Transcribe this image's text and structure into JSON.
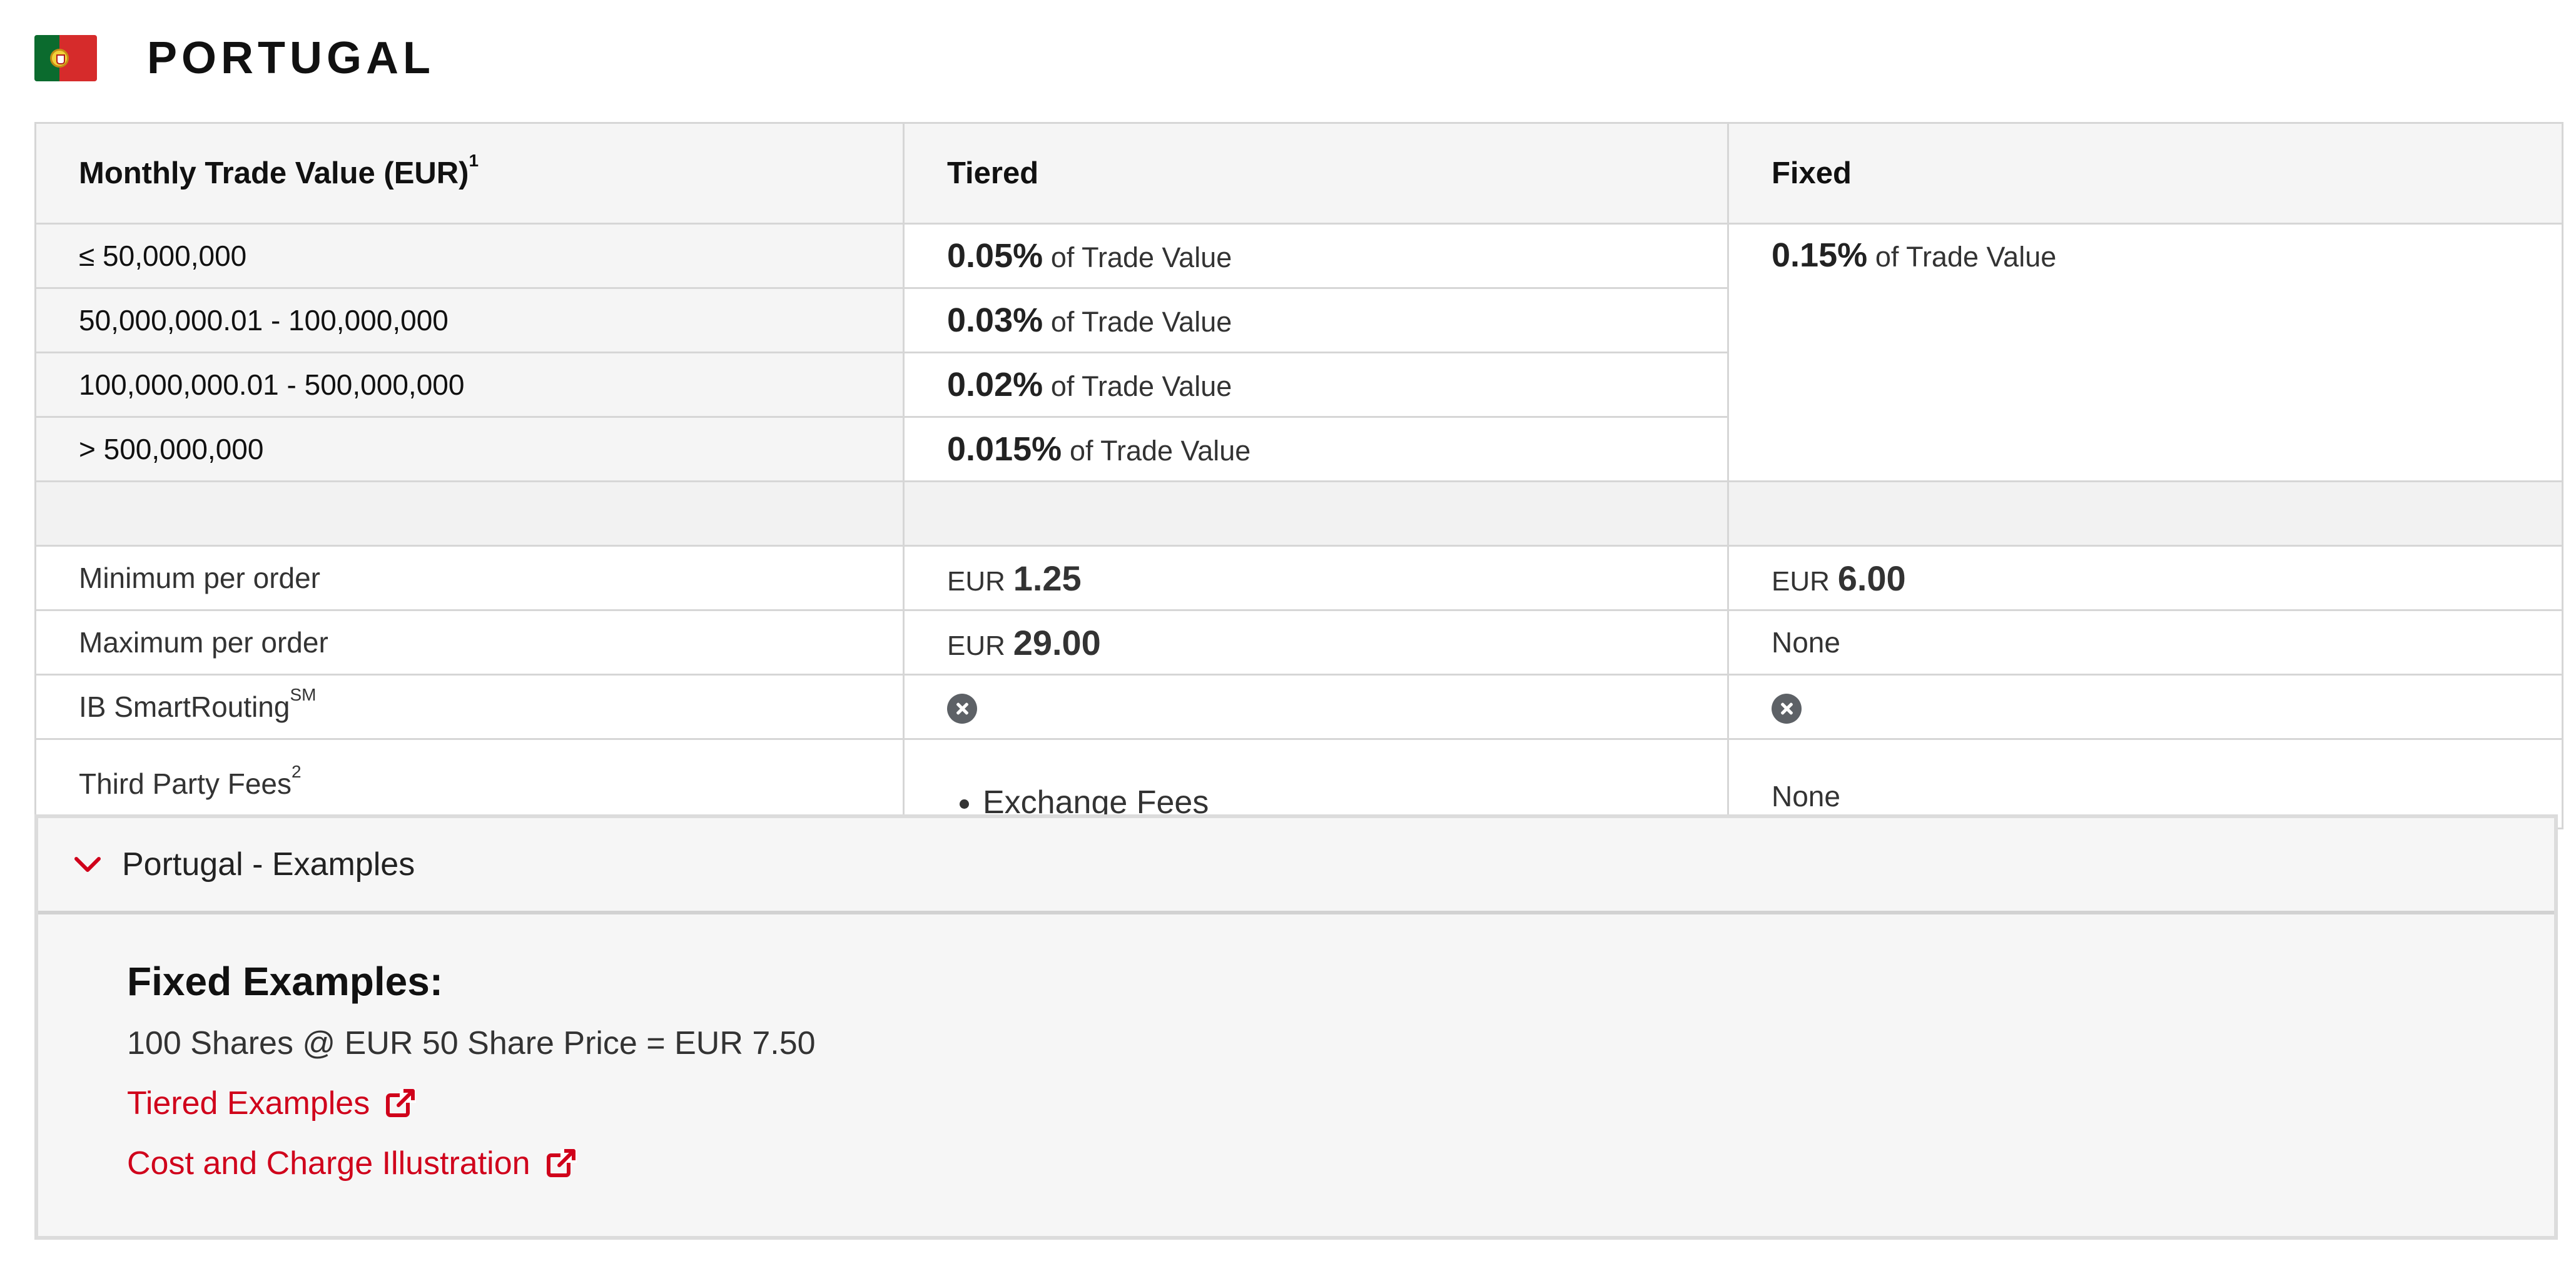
{
  "header": {
    "country": "PORTUGAL",
    "flag_icon": "portugal-flag-icon"
  },
  "table": {
    "headers": {
      "volume": "Monthly Trade Value (EUR)",
      "volume_note": "1",
      "tiered": "Tiered",
      "fixed": "Fixed"
    },
    "tiers": [
      {
        "range": "≤ 50,000,000",
        "pct": "0.05%",
        "suffix": "of Trade Value"
      },
      {
        "range": "50,000,000.01 - 100,000,000",
        "pct": "0.03%",
        "suffix": "of Trade Value"
      },
      {
        "range": "100,000,000.01 - 500,000,000",
        "pct": "0.02%",
        "suffix": "of Trade Value"
      },
      {
        "range": "> 500,000,000",
        "pct": "0.015%",
        "suffix": "of Trade Value"
      }
    ],
    "fixed_rate": {
      "pct": "0.15%",
      "suffix": "of Trade Value"
    },
    "minimum": {
      "label": "Minimum per order",
      "tiered_cur": "EUR",
      "tiered_amt": "1.25",
      "fixed_cur": "EUR",
      "fixed_amt": "6.00"
    },
    "maximum": {
      "label": "Maximum per order",
      "tiered_cur": "EUR",
      "tiered_amt": "29.00",
      "fixed": "None"
    },
    "smart_routing": {
      "label": "IB SmartRouting",
      "sup": "SM",
      "tiered_icon": "x-circle-icon",
      "fixed_icon": "x-circle-icon"
    },
    "third_party": {
      "label": "Third Party Fees",
      "sup": "2",
      "tiered_items": [
        "Exchange Fees"
      ],
      "fixed": "None"
    }
  },
  "examples": {
    "title": "Portugal - Examples",
    "fixed_title": "Fixed Examples:",
    "fixed_line": "100 Shares @ EUR 50 Share Price = EUR 7.50",
    "link_tiered": "Tiered Examples",
    "link_cost": "Cost and Charge Illustration"
  },
  "colors": {
    "accent_red": "#d0021b",
    "icon_gray": "#5d6166",
    "header_bg": "#f5f5f5",
    "border": "#d6d6d6"
  }
}
